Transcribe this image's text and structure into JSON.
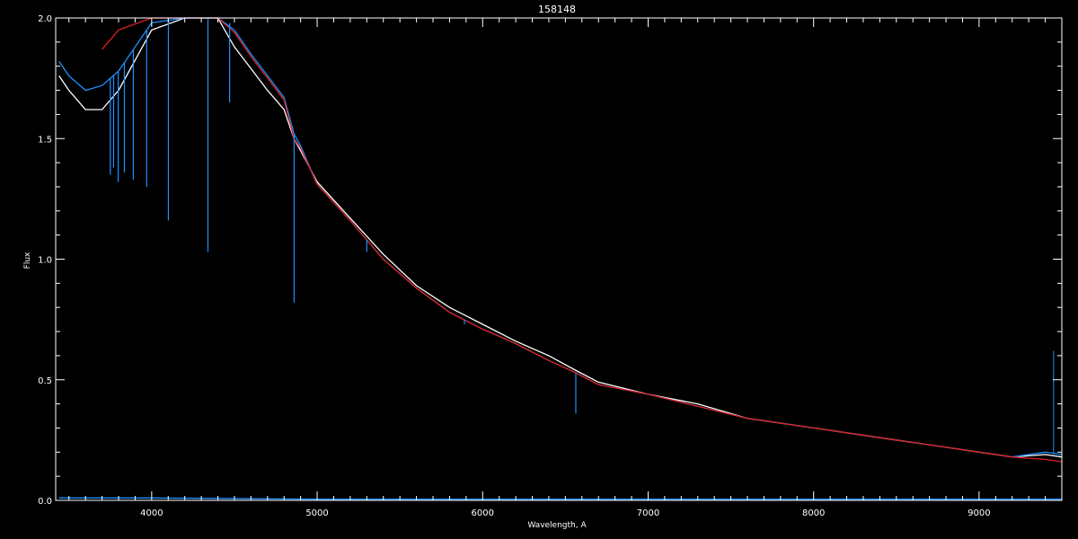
{
  "chart_data": {
    "type": "line",
    "title": "158148",
    "xlabel": "Wavelength, A",
    "ylabel": "Flux",
    "xlim": [
      3420,
      9500
    ],
    "ylim": [
      0.0,
      2.0
    ],
    "grid": false,
    "x_ticks": [
      {
        "value": 4000,
        "label": "4000"
      },
      {
        "value": 5000,
        "label": "5000"
      },
      {
        "value": 6000,
        "label": "6000"
      },
      {
        "value": 7000,
        "label": "7000"
      },
      {
        "value": 8000,
        "label": "8000"
      },
      {
        "value": 9000,
        "label": "9000"
      }
    ],
    "y_ticks": [
      {
        "value": 0.0,
        "label": "0.0"
      },
      {
        "value": 0.5,
        "label": "0.5"
      },
      {
        "value": 1.0,
        "label": "1.0"
      },
      {
        "value": 1.5,
        "label": "1.5"
      },
      {
        "value": 2.0,
        "label": "2.0"
      }
    ],
    "series": [
      {
        "color": "#ffffff",
        "role": "observed spectrum",
        "x": [
          3440,
          3500,
          3600,
          3700,
          3800,
          4000,
          4200,
          4400,
          4500,
          4600,
          4700,
          4800,
          4860,
          4900,
          5000,
          5200,
          5400,
          5600,
          5800,
          6000,
          6200,
          6400,
          6560,
          6700,
          7000,
          7300,
          7600,
          8000,
          8400,
          8800,
          9000,
          9200,
          9400,
          9500
        ],
        "y": [
          1.76,
          1.7,
          1.62,
          1.62,
          1.7,
          1.95,
          2.02,
          2.02,
          1.88,
          1.79,
          1.7,
          1.62,
          1.5,
          1.45,
          1.32,
          1.17,
          1.02,
          0.89,
          0.8,
          0.73,
          0.66,
          0.6,
          0.54,
          0.49,
          0.44,
          0.4,
          0.34,
          0.3,
          0.26,
          0.22,
          0.2,
          0.18,
          0.19,
          0.18
        ]
      },
      {
        "color": "#1e90ff",
        "role": "observed spectrum (alternate)",
        "x": [
          3440,
          3500,
          3600,
          3700,
          3800,
          4000,
          4200,
          4400,
          4500,
          4600,
          4700,
          4800,
          4860,
          4900,
          5000,
          5200,
          5400,
          5600,
          5800,
          6000,
          6200,
          6400,
          6560,
          6700,
          7000,
          7300,
          7600,
          8000,
          8400,
          8800,
          9000,
          9200,
          9400,
          9500
        ],
        "y": [
          1.82,
          1.76,
          1.7,
          1.72,
          1.78,
          1.98,
          2.05,
          2.05,
          1.95,
          1.85,
          1.76,
          1.67,
          1.52,
          1.47,
          1.31,
          1.16,
          1.0,
          0.88,
          0.78,
          0.71,
          0.65,
          0.58,
          0.53,
          0.48,
          0.44,
          0.39,
          0.34,
          0.3,
          0.26,
          0.22,
          0.2,
          0.18,
          0.2,
          0.19
        ]
      },
      {
        "color": "#e02020",
        "role": "model fit",
        "x": [
          3700,
          3800,
          4000,
          4200,
          4400,
          4500,
          4600,
          4700,
          4800,
          4860,
          4900,
          5000,
          5200,
          5400,
          5600,
          5800,
          6000,
          6200,
          6400,
          6560,
          6700,
          7000,
          7300,
          7600,
          8000,
          8400,
          8800,
          9000,
          9200,
          9400,
          9500
        ],
        "y": [
          1.87,
          1.95,
          2.05,
          2.08,
          2.05,
          1.94,
          1.84,
          1.75,
          1.66,
          1.5,
          1.46,
          1.31,
          1.16,
          1.0,
          0.88,
          0.78,
          0.71,
          0.65,
          0.58,
          0.53,
          0.48,
          0.44,
          0.39,
          0.34,
          0.3,
          0.26,
          0.22,
          0.2,
          0.18,
          0.17,
          0.16
        ]
      },
      {
        "color": "#1e90ff",
        "role": "error / baseline",
        "x": [
          3440,
          4000,
          5000,
          6000,
          7000,
          8000,
          9000,
          9500
        ],
        "y": [
          0.01,
          0.01,
          0.005,
          0.005,
          0.005,
          0.005,
          0.005,
          0.005
        ]
      }
    ],
    "absorption_lines": [
      {
        "x": 3750,
        "depth_to": 1.35
      },
      {
        "x": 3770,
        "depth_to": 1.38
      },
      {
        "x": 3798,
        "depth_to": 1.32
      },
      {
        "x": 3835,
        "depth_to": 1.36
      },
      {
        "x": 3889,
        "depth_to": 1.33
      },
      {
        "x": 3970,
        "depth_to": 1.3
      },
      {
        "x": 4101,
        "depth_to": 1.16
      },
      {
        "x": 4340,
        "depth_to": 1.03
      },
      {
        "x": 4471,
        "depth_to": 1.65
      },
      {
        "x": 4861,
        "depth_to": 0.82
      },
      {
        "x": 5300,
        "depth_to": 1.03
      },
      {
        "x": 5890,
        "depth_to": 0.73
      },
      {
        "x": 6563,
        "depth_to": 0.36
      }
    ],
    "emission_spike": {
      "x": 9450,
      "peak": 0.62
    }
  }
}
